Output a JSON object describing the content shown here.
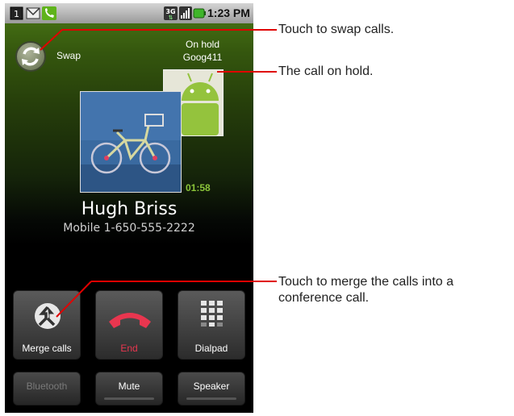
{
  "status_bar": {
    "time": "1:23 PM"
  },
  "swap": {
    "label": "Swap"
  },
  "hold": {
    "status": "On hold",
    "name": "Goog411"
  },
  "call": {
    "elapsed": "01:58",
    "caller_name": "Hugh Briss",
    "caller_number": "Mobile 1-650-555-2222"
  },
  "buttons": {
    "merge": "Merge calls",
    "end": "End",
    "dialpad": "Dialpad",
    "bluetooth": "Bluetooth",
    "mute": "Mute",
    "speaker": "Speaker"
  },
  "callouts": {
    "swap": "Touch to swap calls.",
    "hold": "The call on hold.",
    "merge": "Touch to merge the calls into a conference call."
  },
  "colors": {
    "accent_green": "#8bc43a",
    "end_red": "#e8364f",
    "callout_line": "#e00000"
  }
}
